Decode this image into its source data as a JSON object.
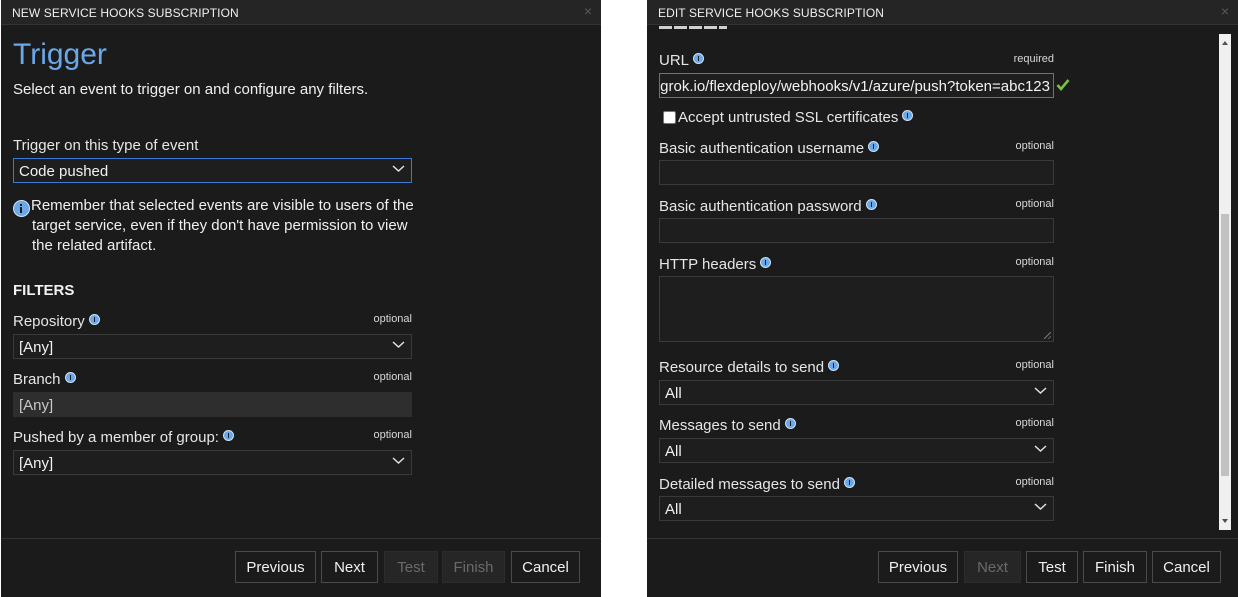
{
  "left_dialog": {
    "title": "NEW SERVICE HOOKS SUBSCRIPTION",
    "close": "×",
    "heading": "Trigger",
    "subtitle": "Select an event to trigger on and configure any filters.",
    "event_label": "Trigger on this type of event",
    "event_value": "Code pushed",
    "notice": "Remember that selected events are visible to users of the target service, even if they don't have permission to view the related artifact.",
    "filters_heading": "FILTERS",
    "filters": [
      {
        "label": "Repository",
        "hint": "optional",
        "value": "[Any]",
        "kind": "select"
      },
      {
        "label": "Branch",
        "hint": "optional",
        "value": "[Any]",
        "kind": "text-disabled"
      },
      {
        "label": "Pushed by a member of group:",
        "hint": "optional",
        "value": "[Any]",
        "kind": "select"
      }
    ],
    "buttons": {
      "previous": "Previous",
      "next": "Next",
      "test": "Test",
      "finish": "Finish",
      "cancel": "Cancel"
    }
  },
  "right_dialog": {
    "title": "EDIT SERVICE HOOKS SUBSCRIPTION",
    "close": "×",
    "url_label": "URL",
    "url_hint": "required",
    "url_value": "grok.io/flexdeploy/webhooks/v1/azure/push?token=abc123",
    "ssl_label": "Accept untrusted SSL certificates",
    "ssl_checked": false,
    "username_label": "Basic authentication username",
    "username_hint": "optional",
    "password_label": "Basic authentication password",
    "password_hint": "optional",
    "headers_label": "HTTP headers",
    "headers_hint": "optional",
    "resource_label": "Resource details to send",
    "resource_hint": "optional",
    "resource_value": "All",
    "messages_label": "Messages to send",
    "messages_hint": "optional",
    "messages_value": "All",
    "detailed_label": "Detailed messages to send",
    "detailed_hint": "optional",
    "detailed_value": "All",
    "buttons": {
      "previous": "Previous",
      "next": "Next",
      "test": "Test",
      "finish": "Finish",
      "cancel": "Cancel"
    }
  },
  "colors": {
    "background": "#1b1b1b",
    "accent": "#6aa8e8",
    "focus_border": "#3b78d8",
    "valid_check": "#7ac143"
  },
  "icons": [
    "info-icon",
    "chevron-down-icon",
    "check-icon",
    "close-icon"
  ]
}
